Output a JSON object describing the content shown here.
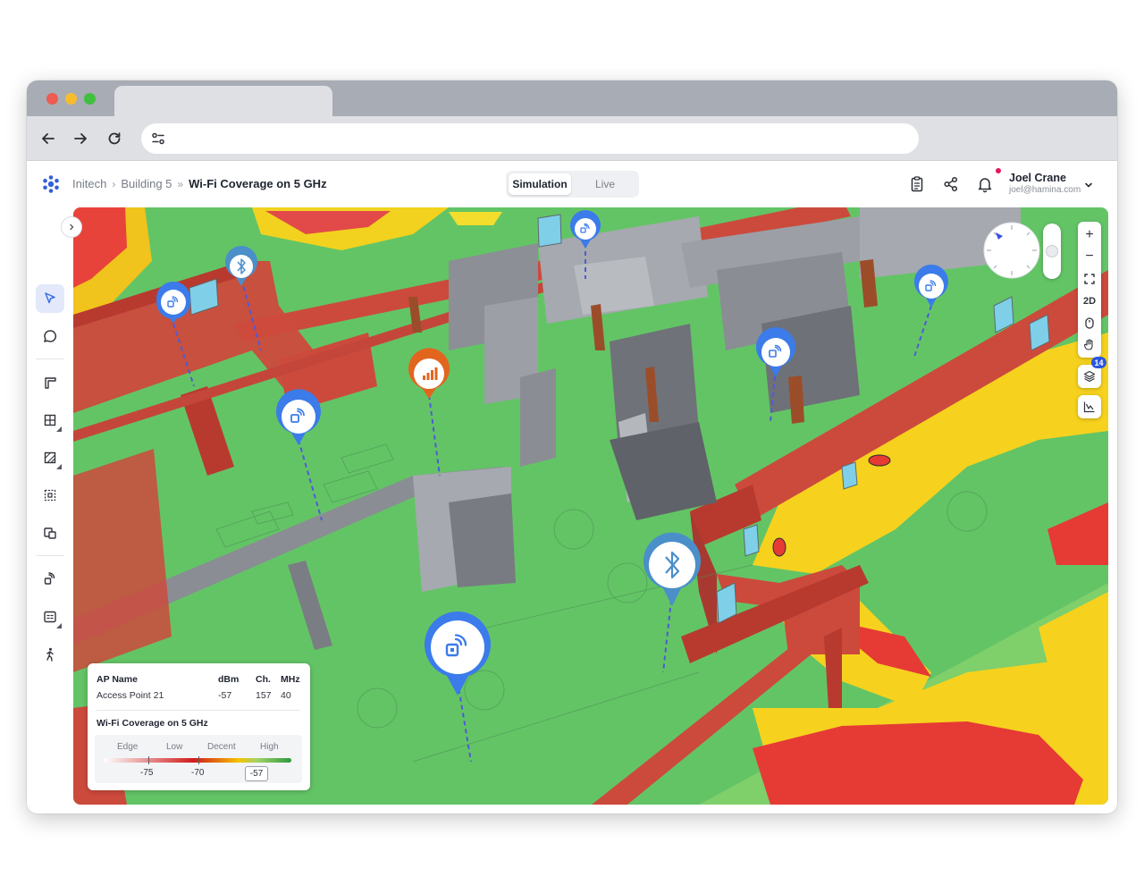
{
  "browser": {
    "url": ""
  },
  "breadcrumb": {
    "org": "Initech",
    "building": "Building 5",
    "sep1": "›",
    "sep2": "»",
    "current": "Wi-Fi Coverage on 5 GHz"
  },
  "mode": {
    "simulation_label": "Simulation",
    "live_label": "Live",
    "selected": "Simulation"
  },
  "user": {
    "name": "Joel Crane",
    "email": "joel@hamina.com"
  },
  "map_controls": {
    "zoom_in": "+",
    "zoom_out": "−",
    "view_2d": "2D",
    "layers_count": "14"
  },
  "ap_info": {
    "headers": {
      "name": "AP Name",
      "dbm": "dBm",
      "channel": "Ch.",
      "mhz": "MHz"
    },
    "row": {
      "name": "Access Point 21",
      "dbm": "-57",
      "channel": "157",
      "mhz": "40"
    }
  },
  "legend": {
    "title": "Wi-Fi Coverage on 5 GHz",
    "labels": [
      "Edge",
      "Low",
      "Decent",
      "High"
    ],
    "thresholds": [
      "-75",
      "-70"
    ],
    "current_value": "-57"
  },
  "colors": {
    "accent": "#3b7bea",
    "floor_green": "#63c466",
    "wall_red": "#cc4a3c",
    "interior_gray": "#777a80",
    "weak_red": "#e63a35",
    "mid_yellow": "#f6d21e",
    "bluetooth_marker": "#4a8fc9",
    "sensor_orange": "#e2651e",
    "badge_blue": "#2a57e0"
  },
  "icons": {
    "ap_marker": "wifi-access-point-icon",
    "bt_marker": "bluetooth-icon",
    "sensor_marker": "signal-bars-icon"
  }
}
